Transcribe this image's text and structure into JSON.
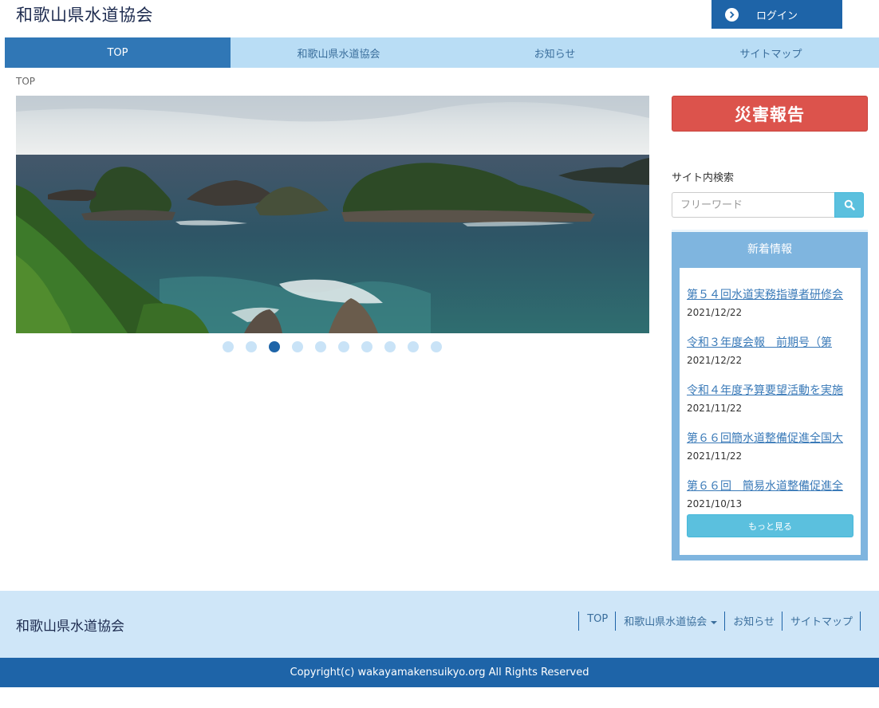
{
  "header": {
    "site_title": "和歌山県水道協会",
    "login_label": "ログイン"
  },
  "nav": {
    "items": [
      {
        "label": "TOP"
      },
      {
        "label": "和歌山県水道協会"
      },
      {
        "label": "お知らせ"
      },
      {
        "label": "サイトマップ"
      }
    ],
    "active": "TOP"
  },
  "breadcrumb": "TOP",
  "slider": {
    "slide_count": 10,
    "active_index": 3,
    "image_subject": "coastal islands seascape"
  },
  "sidebar": {
    "disaster_button": "災害報告",
    "search_label": "サイト内検索",
    "search_placeholder": "フリーワード",
    "news": {
      "title": "新着情報",
      "items": [
        {
          "title": "第５４回水道実務指導者研修会",
          "date": "2021/12/22"
        },
        {
          "title": "令和３年度会報　前期号（第",
          "date": "2021/12/22"
        },
        {
          "title": "令和４年度予算要望活動を実施",
          "date": "2021/11/22"
        },
        {
          "title": "第６６回簡水道整備促進全国大",
          "date": "2021/11/22"
        },
        {
          "title": "第６６回　簡易水道整備促進全",
          "date": "2021/10/13"
        }
      ],
      "more_label": "もっと見る"
    }
  },
  "footer": {
    "site_title": "和歌山県水道協会",
    "nav": [
      {
        "label": "TOP"
      },
      {
        "label": "和歌山県水道協会"
      },
      {
        "label": "お知らせ"
      },
      {
        "label": "サイトマップ"
      }
    ],
    "copyright": "Copyright(c) wakayamakensuikyo.org All Rights Reserved"
  },
  "colors": {
    "primary": "#1e64a8",
    "nav_bg": "#b9ddf5",
    "nav_active": "#3077b6",
    "disaster": "#dc534c",
    "info": "#5bc0de",
    "news_panel": "#7fb5df",
    "footer_bg": "#cfe6f8"
  },
  "icons": {
    "login": "chevron-circle-right-icon",
    "search": "search-icon",
    "footer_dropdown": "caret-down-icon"
  }
}
